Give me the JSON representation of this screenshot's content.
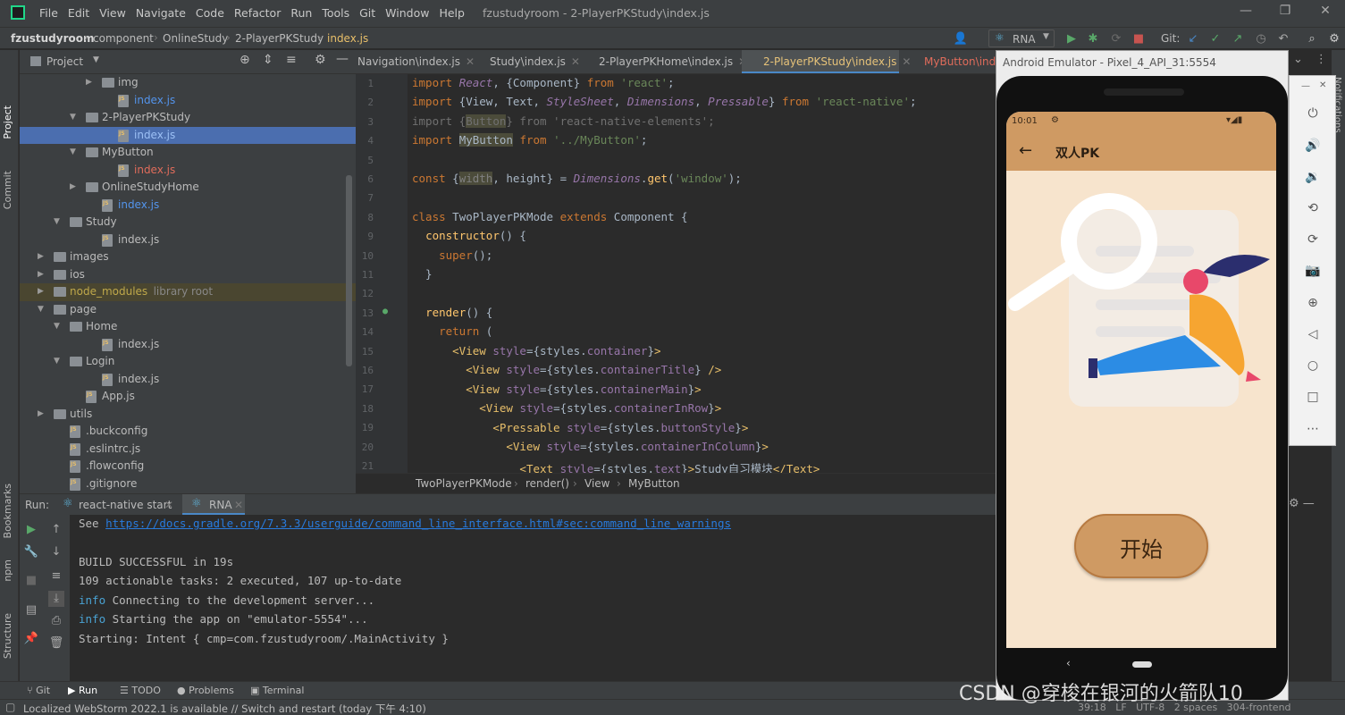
{
  "titlebar": {
    "menu": [
      "File",
      "Edit",
      "View",
      "Navigate",
      "Code",
      "Refactor",
      "Run",
      "Tools",
      "Git",
      "Window",
      "Help"
    ],
    "window_title": "fzustudyroom - 2-PlayerPKStudy\\index.js"
  },
  "navbar": {
    "crumbs": [
      "fzustudyroom",
      "component",
      "OnlineStudy",
      "2-PlayerPKStudy",
      "index.js"
    ],
    "run_config": "RNA",
    "git_label": "Git:"
  },
  "left_stripe": {
    "tabs": [
      "Project",
      "Commit",
      "Bookmarks",
      "npm",
      "Structure"
    ]
  },
  "project": {
    "header": "Project",
    "tree": [
      {
        "label": "img",
        "depth": 4,
        "type": "folder",
        "arrow": "▶",
        "color": ""
      },
      {
        "label": "index.js",
        "depth": 5,
        "type": "file",
        "arrow": "",
        "color": "blue"
      },
      {
        "label": "2-PlayerPKStudy",
        "depth": 3,
        "type": "folder",
        "arrow": "▼",
        "color": ""
      },
      {
        "label": "index.js",
        "depth": 5,
        "type": "file",
        "arrow": "",
        "color": "blue"
      },
      {
        "label": "MyButton",
        "depth": 3,
        "type": "folder",
        "arrow": "▼",
        "color": ""
      },
      {
        "label": "index.js",
        "depth": 5,
        "type": "file",
        "arrow": "",
        "color": "red"
      },
      {
        "label": "OnlineStudyHome",
        "depth": 3,
        "type": "folder",
        "arrow": "▶",
        "color": ""
      },
      {
        "label": "index.js",
        "depth": 4,
        "type": "file",
        "arrow": "",
        "color": "blue"
      },
      {
        "label": "Study",
        "depth": 2,
        "type": "folder",
        "arrow": "▼",
        "color": ""
      },
      {
        "label": "index.js",
        "depth": 4,
        "type": "file",
        "arrow": "",
        "color": ""
      },
      {
        "label": "images",
        "depth": 1,
        "type": "folder",
        "arrow": "▶",
        "color": ""
      },
      {
        "label": "ios",
        "depth": 1,
        "type": "folder",
        "arrow": "▶",
        "color": ""
      },
      {
        "label": "node_modules",
        "depth": 1,
        "type": "folder",
        "arrow": "▶",
        "color": "yellow",
        "suffix": "library root"
      },
      {
        "label": "page",
        "depth": 1,
        "type": "folder",
        "arrow": "▼",
        "color": ""
      },
      {
        "label": "Home",
        "depth": 2,
        "type": "folder",
        "arrow": "▼",
        "color": ""
      },
      {
        "label": "index.js",
        "depth": 4,
        "type": "file",
        "arrow": "",
        "color": ""
      },
      {
        "label": "Login",
        "depth": 2,
        "type": "folder",
        "arrow": "▼",
        "color": ""
      },
      {
        "label": "index.js",
        "depth": 4,
        "type": "file",
        "arrow": "",
        "color": ""
      },
      {
        "label": "App.js",
        "depth": 3,
        "type": "file",
        "arrow": "",
        "color": ""
      },
      {
        "label": "utils",
        "depth": 1,
        "type": "folder",
        "arrow": "▶",
        "color": ""
      },
      {
        "label": ".buckconfig",
        "depth": 2,
        "type": "file",
        "arrow": "",
        "color": ""
      },
      {
        "label": ".eslintrc.js",
        "depth": 2,
        "type": "file",
        "arrow": "",
        "color": ""
      },
      {
        "label": ".flowconfig",
        "depth": 2,
        "type": "file",
        "arrow": "",
        "color": ""
      },
      {
        "label": ".gitignore",
        "depth": 2,
        "type": "file",
        "arrow": "",
        "color": ""
      }
    ]
  },
  "editor": {
    "tabs": [
      "Navigation\\index.js",
      "Study\\index.js",
      "2-PlayerPKHome\\index.js",
      "2-PlayerPKStudy\\index.js",
      "MyButton\\inde"
    ],
    "line_numbers": [
      "1",
      "2",
      "3",
      "4",
      "5",
      "6",
      "7",
      "8",
      "9",
      "10",
      "11",
      "12",
      "13",
      "14",
      "15",
      "16",
      "17",
      "18",
      "19",
      "20",
      "21"
    ],
    "breadcrumbs": [
      "TwoPlayerPKMode",
      "render()",
      "View",
      "MyButton"
    ]
  },
  "run": {
    "label": "Run:",
    "tabs": [
      "react-native start",
      "RNA"
    ],
    "console": {
      "see_prefix": "See ",
      "link": "https://docs.gradle.org/7.3.3/userguide/command_line_interface.html#sec:command_line_warnings",
      "build": "BUILD SUCCESSFUL in 19s",
      "tasks": "109 actionable tasks: 2 executed, 107 up-to-date",
      "info_tag": "info",
      "info1": " Connecting to the development server...",
      "info2": " Starting the app on \"emulator-5554\"...",
      "intent": "Starting: Intent { cmp=com.fzustudyroom/.MainActivity }"
    }
  },
  "tool_tabs": [
    "Git",
    "Run",
    "TODO",
    "Problems",
    "Terminal"
  ],
  "status": {
    "message": "Localized WebStorm 2022.1 is available // Switch and restart (today 下午 4:10)",
    "right": "39:18   LF   UTF-8   2 spaces   304-frontend"
  },
  "emulator": {
    "title": "Android Emulator - Pixel_4_API_31:5554",
    "time": "10:01",
    "app_title": "双人PK",
    "start_button": "开始",
    "colors": {
      "appbar": "#cf9a63",
      "background": "#f7e4cd",
      "button": "#cf9a63"
    }
  },
  "right_stripe": {
    "tab": "Notifications"
  },
  "watermark": "CSDN @穿梭在银河的火箭队10"
}
